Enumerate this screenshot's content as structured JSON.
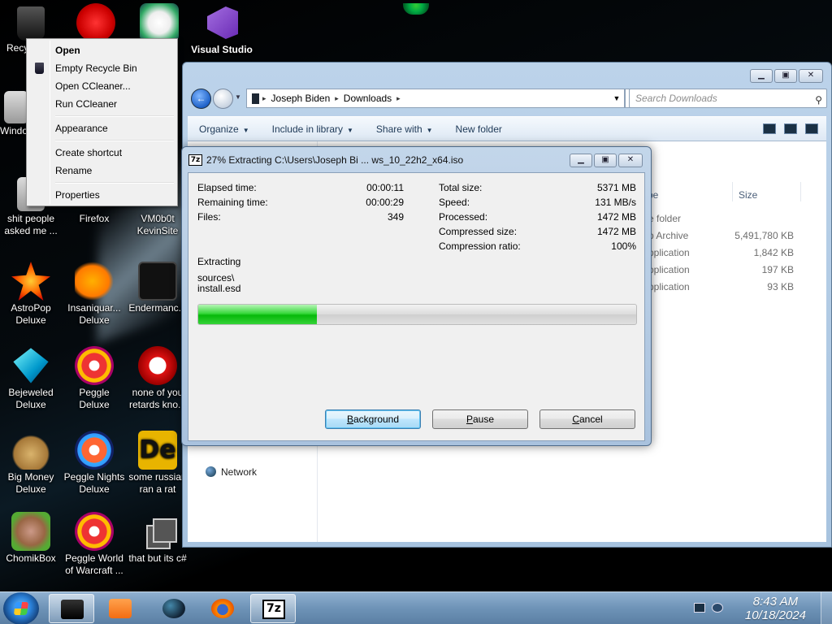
{
  "desktop": {
    "icons": [
      {
        "label": "Recy",
        "icon": "recycle-bin-icon"
      },
      {
        "label": "",
        "icon": "red-creature-icon"
      },
      {
        "label": "",
        "icon": "flower-icon"
      },
      {
        "label": "Visual Studio",
        "icon": "visual-studio-icon"
      },
      {
        "label": "Windo",
        "icon": "document-icon"
      },
      {
        "label": "shit people asked me ...",
        "icon": "document-icon"
      },
      {
        "label": "Firefox",
        "icon": "firefox-icon"
      },
      {
        "label": "VM0b0t KevinSite",
        "icon": "vm-icon"
      },
      {
        "label": "AstroPop Deluxe",
        "icon": "astropop-icon"
      },
      {
        "label": "Insaniquar... Deluxe",
        "icon": "fish-icon"
      },
      {
        "label": "Endermanc...",
        "icon": "list-icon"
      },
      {
        "label": "Bejeweled Deluxe",
        "icon": "gem-icon"
      },
      {
        "label": "Peggle Deluxe",
        "icon": "peggle-icon"
      },
      {
        "label": "none of you retards kno...",
        "icon": "dino-icon"
      },
      {
        "label": "Big Money Deluxe",
        "icon": "money-bag-icon"
      },
      {
        "label": "Peggle Nights Deluxe",
        "icon": "peggle-nights-icon"
      },
      {
        "label": "some russian ran a rat",
        "icon": "de-icon"
      },
      {
        "label": "ChomikBox",
        "icon": "chomikbox-icon"
      },
      {
        "label": "Peggle World of Warcraft ...",
        "icon": "peggle-wow-icon"
      },
      {
        "label": "that but its c#",
        "icon": "stack-icon"
      }
    ]
  },
  "context_menu": {
    "items": [
      "Open",
      "Empty Recycle Bin",
      "Open CCleaner...",
      "Run CCleaner",
      "Appearance",
      "Create shortcut",
      "Rename",
      "Properties"
    ]
  },
  "explorer": {
    "breadcrumb": [
      "Joseph Biden",
      "Downloads"
    ],
    "search_placeholder": "Search Downloads",
    "commands": [
      "Organize",
      "Include in library",
      "Share with",
      "New folder"
    ],
    "col_type": "pe",
    "col_size": "Size",
    "rows": [
      {
        "type": "e folder",
        "size": ""
      },
      {
        "type": "p Archive",
        "size": "5,491,780 KB"
      },
      {
        "type": "pplication",
        "size": "1,842 KB"
      },
      {
        "type": "pplication",
        "size": "197 KB"
      },
      {
        "type": "pplication",
        "size": "93 KB"
      }
    ],
    "nav_network": "Network"
  },
  "dialog": {
    "logo": "7z",
    "title": "27% Extracting C:\\Users\\Joseph Bi ... ws_10_22h2_x64.iso",
    "progress": 0.27,
    "left_stats": [
      {
        "k": "Elapsed time:",
        "v": "00:00:11"
      },
      {
        "k": "Remaining time:",
        "v": "00:00:29"
      },
      {
        "k": "Files:",
        "v": "349"
      }
    ],
    "right_stats": [
      {
        "k": "Total size:",
        "v": "5371 MB"
      },
      {
        "k": "Speed:",
        "v": "131 MB/s"
      },
      {
        "k": "Processed:",
        "v": "1472 MB"
      },
      {
        "k": "Compressed size:",
        "v": "1472 MB"
      },
      {
        "k": "Compression ratio:",
        "v": "100%"
      }
    ],
    "status": "Extracting",
    "path_line1": "sources\\",
    "path_line2": "install.esd",
    "btn_background": "Background",
    "btn_pause": "Pause",
    "btn_cancel": "Cancel"
  },
  "taskbar": {
    "time": "8:43 AM",
    "date": "10/18/2024",
    "sevenzip_label": "7z"
  },
  "colors": {
    "progress": "#06b90a",
    "taskbar": "#6e93b7"
  }
}
